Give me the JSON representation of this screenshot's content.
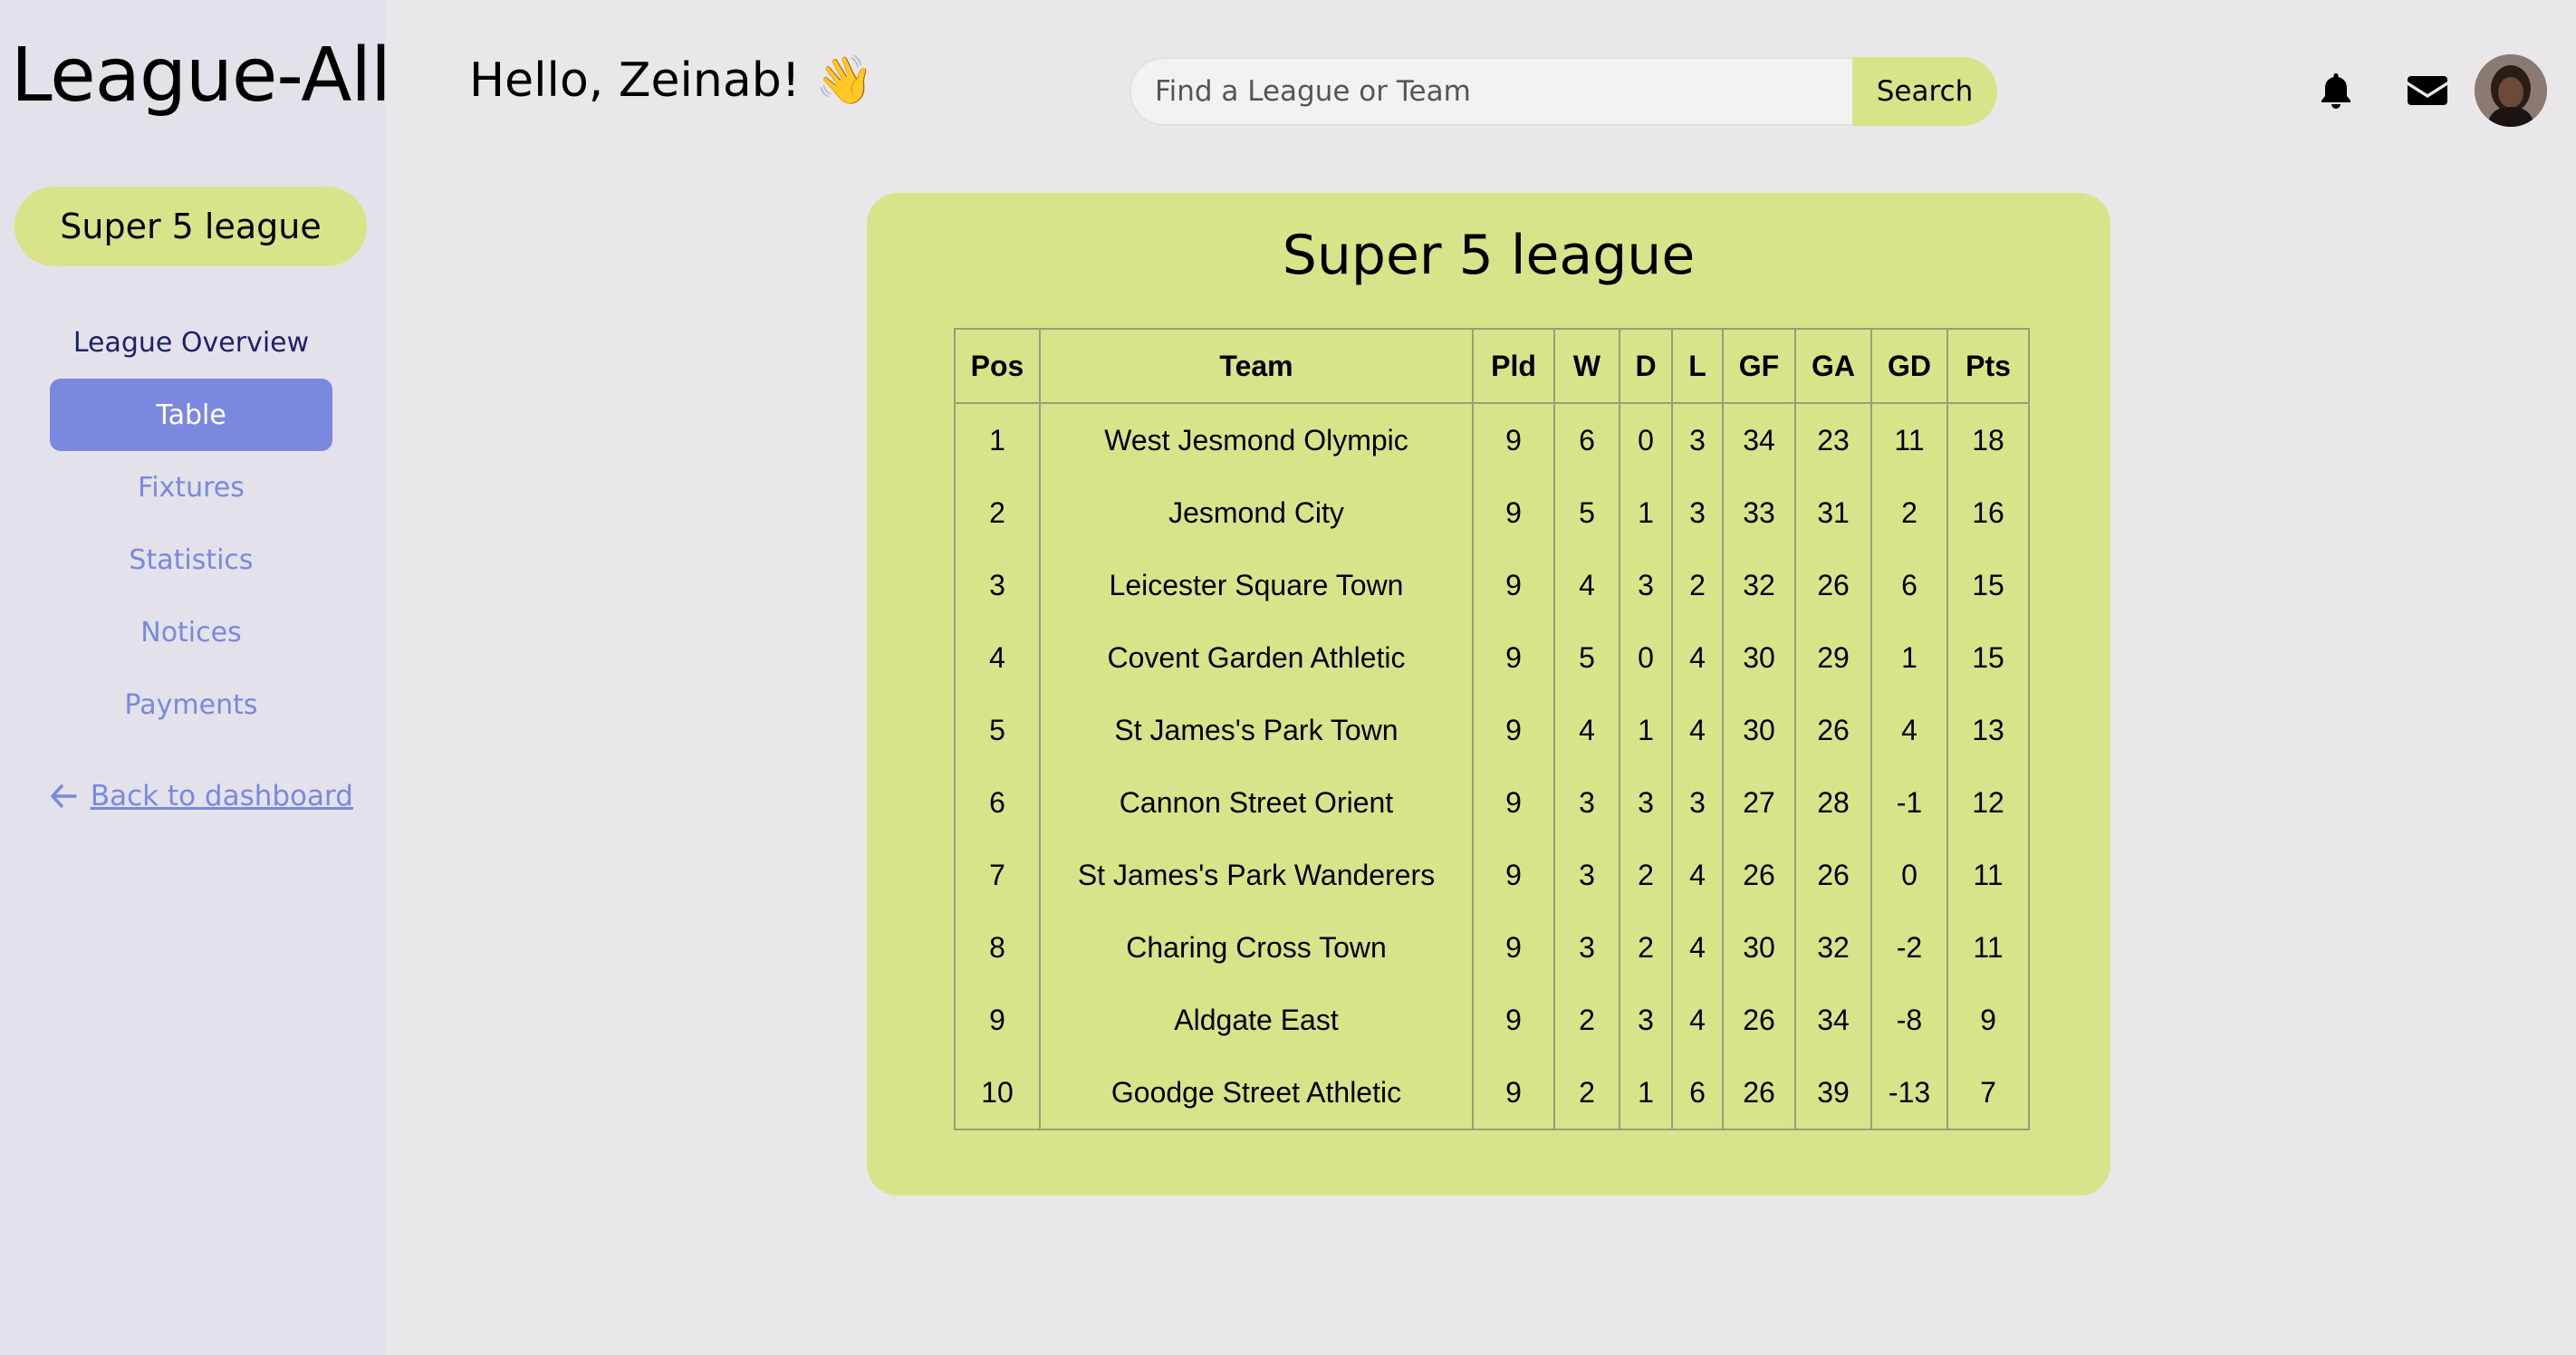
{
  "app": {
    "name": "League-All"
  },
  "sidebar": {
    "league_name": "Super 5 league",
    "nav": [
      {
        "label": "League Overview"
      },
      {
        "label": "Table"
      },
      {
        "label": "Fixtures"
      },
      {
        "label": "Statistics"
      },
      {
        "label": "Notices"
      },
      {
        "label": "Payments"
      }
    ],
    "active_item": "Table",
    "back_link": "Back to dashboard",
    "back_icon": "arrow-left-icon"
  },
  "header": {
    "greeting": "Hello, Zeinab! 👋",
    "search": {
      "placeholder": "Find a League or Team",
      "value": "",
      "button_label": "Search"
    },
    "icons": [
      "bell-icon",
      "envelope-icon"
    ]
  },
  "colors": {
    "accent_lime": "#dbe38a",
    "accent_blue": "#7b88df",
    "sidebar_bg": "#e3e1ea",
    "page_bg": "#e9e7ea",
    "nav_overview": "#1c2268"
  },
  "main": {
    "title": "Super 5 league",
    "table": {
      "headers": [
        "Pos",
        "Team",
        "Pld",
        "W",
        "D",
        "L",
        "GF",
        "GA",
        "GD",
        "Pts"
      ],
      "rows": [
        [
          "1",
          "West Jesmond Olympic",
          "9",
          "6",
          "0",
          "3",
          "34",
          "23",
          "11",
          "18"
        ],
        [
          "2",
          "Jesmond City",
          "9",
          "5",
          "1",
          "3",
          "33",
          "31",
          "2",
          "16"
        ],
        [
          "3",
          "Leicester Square Town",
          "9",
          "4",
          "3",
          "2",
          "32",
          "26",
          "6",
          "15"
        ],
        [
          "4",
          "Covent Garden Athletic",
          "9",
          "5",
          "0",
          "4",
          "30",
          "29",
          "1",
          "15"
        ],
        [
          "5",
          "St James's Park Town",
          "9",
          "4",
          "1",
          "4",
          "30",
          "26",
          "4",
          "13"
        ],
        [
          "6",
          "Cannon Street Orient",
          "9",
          "3",
          "3",
          "3",
          "27",
          "28",
          "-1",
          "12"
        ],
        [
          "7",
          "St James's Park Wanderers",
          "9",
          "3",
          "2",
          "4",
          "26",
          "26",
          "0",
          "11"
        ],
        [
          "8",
          "Charing Cross Town",
          "9",
          "3",
          "2",
          "4",
          "30",
          "32",
          "-2",
          "11"
        ],
        [
          "9",
          "Aldgate East",
          "9",
          "2",
          "3",
          "4",
          "26",
          "34",
          "-8",
          "9"
        ],
        [
          "10",
          "Goodge Street Athletic",
          "9",
          "2",
          "1",
          "6",
          "26",
          "39",
          "-13",
          "7"
        ]
      ]
    }
  }
}
